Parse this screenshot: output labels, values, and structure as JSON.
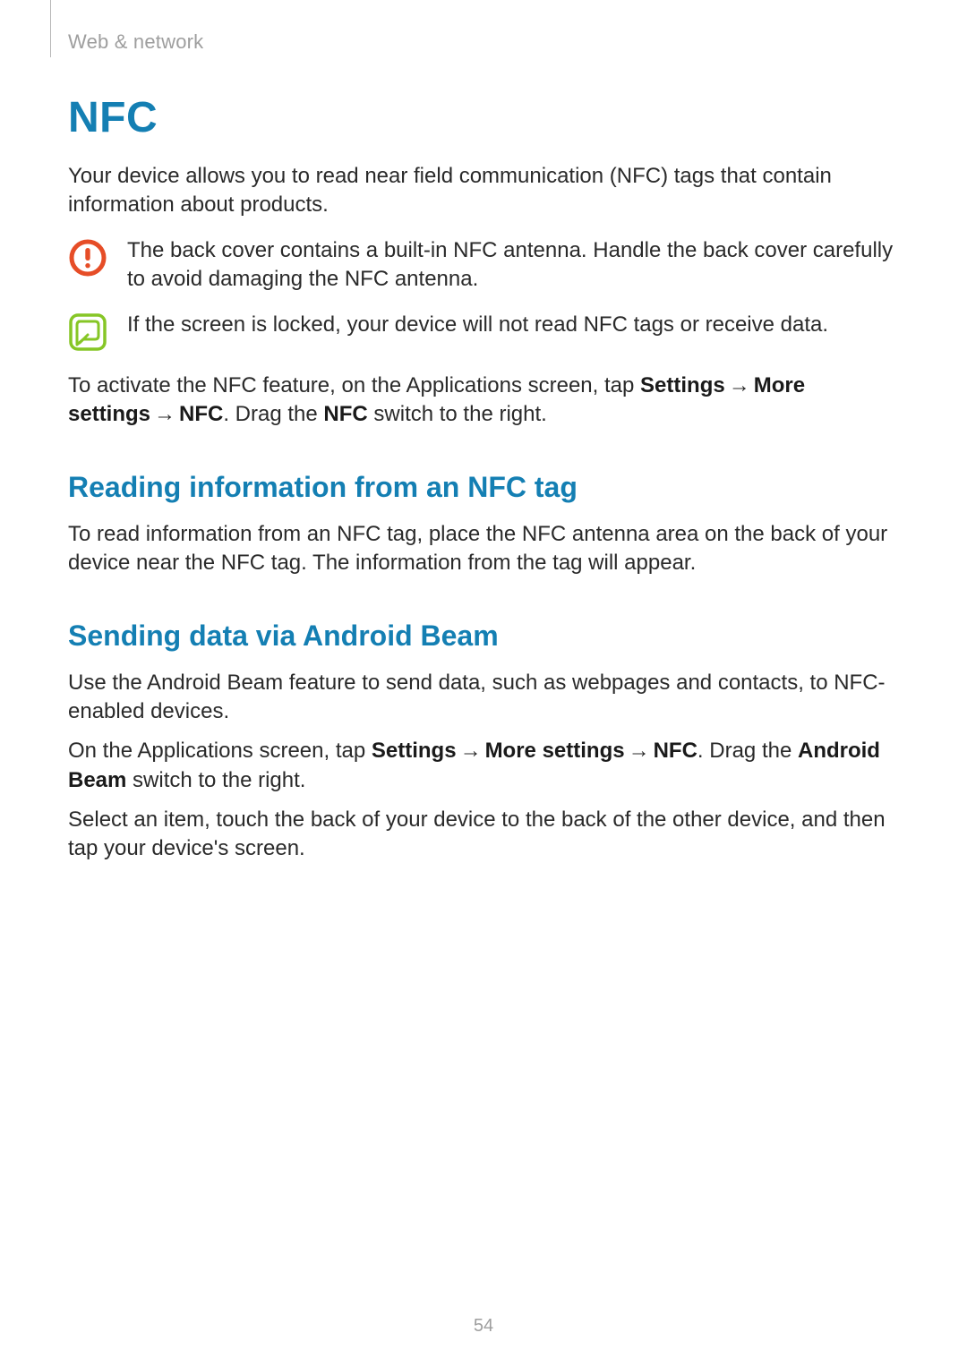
{
  "header": {
    "section": "Web & network"
  },
  "page_number": "54",
  "title": "NFC",
  "intro": "Your device allows you to read near field communication (NFC) tags that contain information about products.",
  "warn": "The back cover contains a built-in NFC antenna. Handle the back cover carefully to avoid damaging the NFC antenna.",
  "note": "If the screen is locked, your device will not read NFC tags or receive data.",
  "arrow": "→",
  "activate": {
    "pre": "To activate the NFC feature, on the Applications screen, tap ",
    "b1": "Settings",
    "b2": "More settings",
    "b3": "NFC",
    "mid": ". Drag the ",
    "b4": "NFC",
    "post": " switch to the right."
  },
  "reading": {
    "heading": "Reading information from an NFC tag",
    "body": "To read information from an NFC tag, place the NFC antenna area on the back of your device near the NFC tag. The information from the tag will appear."
  },
  "beam": {
    "heading": "Sending data via Android Beam",
    "p1": "Use the Android Beam feature to send data, such as webpages and contacts, to NFC-enabled devices.",
    "p2_pre": "On the Applications screen, tap ",
    "p2_b1": "Settings",
    "p2_b2": "More settings",
    "p2_b3": "NFC",
    "p2_mid": ". Drag the ",
    "p2_b4": "Android Beam",
    "p2_post": " switch to the right.",
    "p3": "Select an item, touch the back of your device to the back of the other device, and then tap your device's screen."
  }
}
